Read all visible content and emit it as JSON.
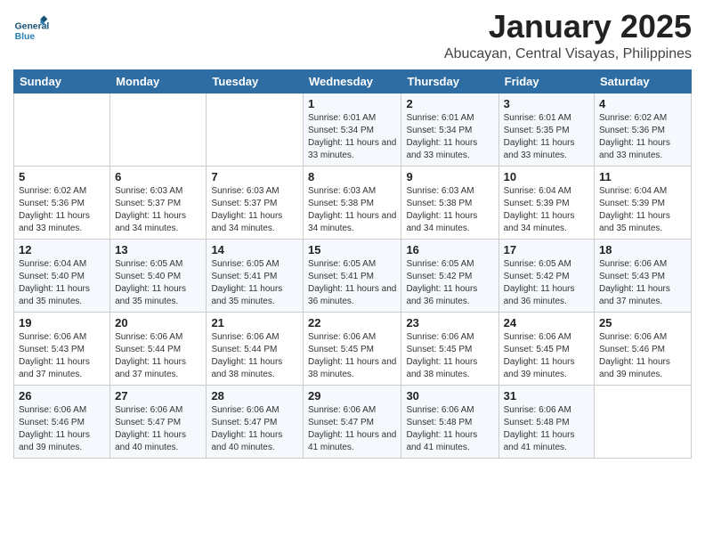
{
  "logo": {
    "text_general": "General",
    "text_blue": "Blue"
  },
  "header": {
    "month": "January 2025",
    "location": "Abucayan, Central Visayas, Philippines"
  },
  "weekdays": [
    "Sunday",
    "Monday",
    "Tuesday",
    "Wednesday",
    "Thursday",
    "Friday",
    "Saturday"
  ],
  "weeks": [
    [
      {
        "day": "",
        "sunrise": "",
        "sunset": "",
        "daylight": ""
      },
      {
        "day": "",
        "sunrise": "",
        "sunset": "",
        "daylight": ""
      },
      {
        "day": "",
        "sunrise": "",
        "sunset": "",
        "daylight": ""
      },
      {
        "day": "1",
        "sunrise": "Sunrise: 6:01 AM",
        "sunset": "Sunset: 5:34 PM",
        "daylight": "Daylight: 11 hours and 33 minutes."
      },
      {
        "day": "2",
        "sunrise": "Sunrise: 6:01 AM",
        "sunset": "Sunset: 5:34 PM",
        "daylight": "Daylight: 11 hours and 33 minutes."
      },
      {
        "day": "3",
        "sunrise": "Sunrise: 6:01 AM",
        "sunset": "Sunset: 5:35 PM",
        "daylight": "Daylight: 11 hours and 33 minutes."
      },
      {
        "day": "4",
        "sunrise": "Sunrise: 6:02 AM",
        "sunset": "Sunset: 5:36 PM",
        "daylight": "Daylight: 11 hours and 33 minutes."
      }
    ],
    [
      {
        "day": "5",
        "sunrise": "Sunrise: 6:02 AM",
        "sunset": "Sunset: 5:36 PM",
        "daylight": "Daylight: 11 hours and 33 minutes."
      },
      {
        "day": "6",
        "sunrise": "Sunrise: 6:03 AM",
        "sunset": "Sunset: 5:37 PM",
        "daylight": "Daylight: 11 hours and 34 minutes."
      },
      {
        "day": "7",
        "sunrise": "Sunrise: 6:03 AM",
        "sunset": "Sunset: 5:37 PM",
        "daylight": "Daylight: 11 hours and 34 minutes."
      },
      {
        "day": "8",
        "sunrise": "Sunrise: 6:03 AM",
        "sunset": "Sunset: 5:38 PM",
        "daylight": "Daylight: 11 hours and 34 minutes."
      },
      {
        "day": "9",
        "sunrise": "Sunrise: 6:03 AM",
        "sunset": "Sunset: 5:38 PM",
        "daylight": "Daylight: 11 hours and 34 minutes."
      },
      {
        "day": "10",
        "sunrise": "Sunrise: 6:04 AM",
        "sunset": "Sunset: 5:39 PM",
        "daylight": "Daylight: 11 hours and 34 minutes."
      },
      {
        "day": "11",
        "sunrise": "Sunrise: 6:04 AM",
        "sunset": "Sunset: 5:39 PM",
        "daylight": "Daylight: 11 hours and 35 minutes."
      }
    ],
    [
      {
        "day": "12",
        "sunrise": "Sunrise: 6:04 AM",
        "sunset": "Sunset: 5:40 PM",
        "daylight": "Daylight: 11 hours and 35 minutes."
      },
      {
        "day": "13",
        "sunrise": "Sunrise: 6:05 AM",
        "sunset": "Sunset: 5:40 PM",
        "daylight": "Daylight: 11 hours and 35 minutes."
      },
      {
        "day": "14",
        "sunrise": "Sunrise: 6:05 AM",
        "sunset": "Sunset: 5:41 PM",
        "daylight": "Daylight: 11 hours and 35 minutes."
      },
      {
        "day": "15",
        "sunrise": "Sunrise: 6:05 AM",
        "sunset": "Sunset: 5:41 PM",
        "daylight": "Daylight: 11 hours and 36 minutes."
      },
      {
        "day": "16",
        "sunrise": "Sunrise: 6:05 AM",
        "sunset": "Sunset: 5:42 PM",
        "daylight": "Daylight: 11 hours and 36 minutes."
      },
      {
        "day": "17",
        "sunrise": "Sunrise: 6:05 AM",
        "sunset": "Sunset: 5:42 PM",
        "daylight": "Daylight: 11 hours and 36 minutes."
      },
      {
        "day": "18",
        "sunrise": "Sunrise: 6:06 AM",
        "sunset": "Sunset: 5:43 PM",
        "daylight": "Daylight: 11 hours and 37 minutes."
      }
    ],
    [
      {
        "day": "19",
        "sunrise": "Sunrise: 6:06 AM",
        "sunset": "Sunset: 5:43 PM",
        "daylight": "Daylight: 11 hours and 37 minutes."
      },
      {
        "day": "20",
        "sunrise": "Sunrise: 6:06 AM",
        "sunset": "Sunset: 5:44 PM",
        "daylight": "Daylight: 11 hours and 37 minutes."
      },
      {
        "day": "21",
        "sunrise": "Sunrise: 6:06 AM",
        "sunset": "Sunset: 5:44 PM",
        "daylight": "Daylight: 11 hours and 38 minutes."
      },
      {
        "day": "22",
        "sunrise": "Sunrise: 6:06 AM",
        "sunset": "Sunset: 5:45 PM",
        "daylight": "Daylight: 11 hours and 38 minutes."
      },
      {
        "day": "23",
        "sunrise": "Sunrise: 6:06 AM",
        "sunset": "Sunset: 5:45 PM",
        "daylight": "Daylight: 11 hours and 38 minutes."
      },
      {
        "day": "24",
        "sunrise": "Sunrise: 6:06 AM",
        "sunset": "Sunset: 5:45 PM",
        "daylight": "Daylight: 11 hours and 39 minutes."
      },
      {
        "day": "25",
        "sunrise": "Sunrise: 6:06 AM",
        "sunset": "Sunset: 5:46 PM",
        "daylight": "Daylight: 11 hours and 39 minutes."
      }
    ],
    [
      {
        "day": "26",
        "sunrise": "Sunrise: 6:06 AM",
        "sunset": "Sunset: 5:46 PM",
        "daylight": "Daylight: 11 hours and 39 minutes."
      },
      {
        "day": "27",
        "sunrise": "Sunrise: 6:06 AM",
        "sunset": "Sunset: 5:47 PM",
        "daylight": "Daylight: 11 hours and 40 minutes."
      },
      {
        "day": "28",
        "sunrise": "Sunrise: 6:06 AM",
        "sunset": "Sunset: 5:47 PM",
        "daylight": "Daylight: 11 hours and 40 minutes."
      },
      {
        "day": "29",
        "sunrise": "Sunrise: 6:06 AM",
        "sunset": "Sunset: 5:47 PM",
        "daylight": "Daylight: 11 hours and 41 minutes."
      },
      {
        "day": "30",
        "sunrise": "Sunrise: 6:06 AM",
        "sunset": "Sunset: 5:48 PM",
        "daylight": "Daylight: 11 hours and 41 minutes."
      },
      {
        "day": "31",
        "sunrise": "Sunrise: 6:06 AM",
        "sunset": "Sunset: 5:48 PM",
        "daylight": "Daylight: 11 hours and 41 minutes."
      },
      {
        "day": "",
        "sunrise": "",
        "sunset": "",
        "daylight": ""
      }
    ]
  ]
}
